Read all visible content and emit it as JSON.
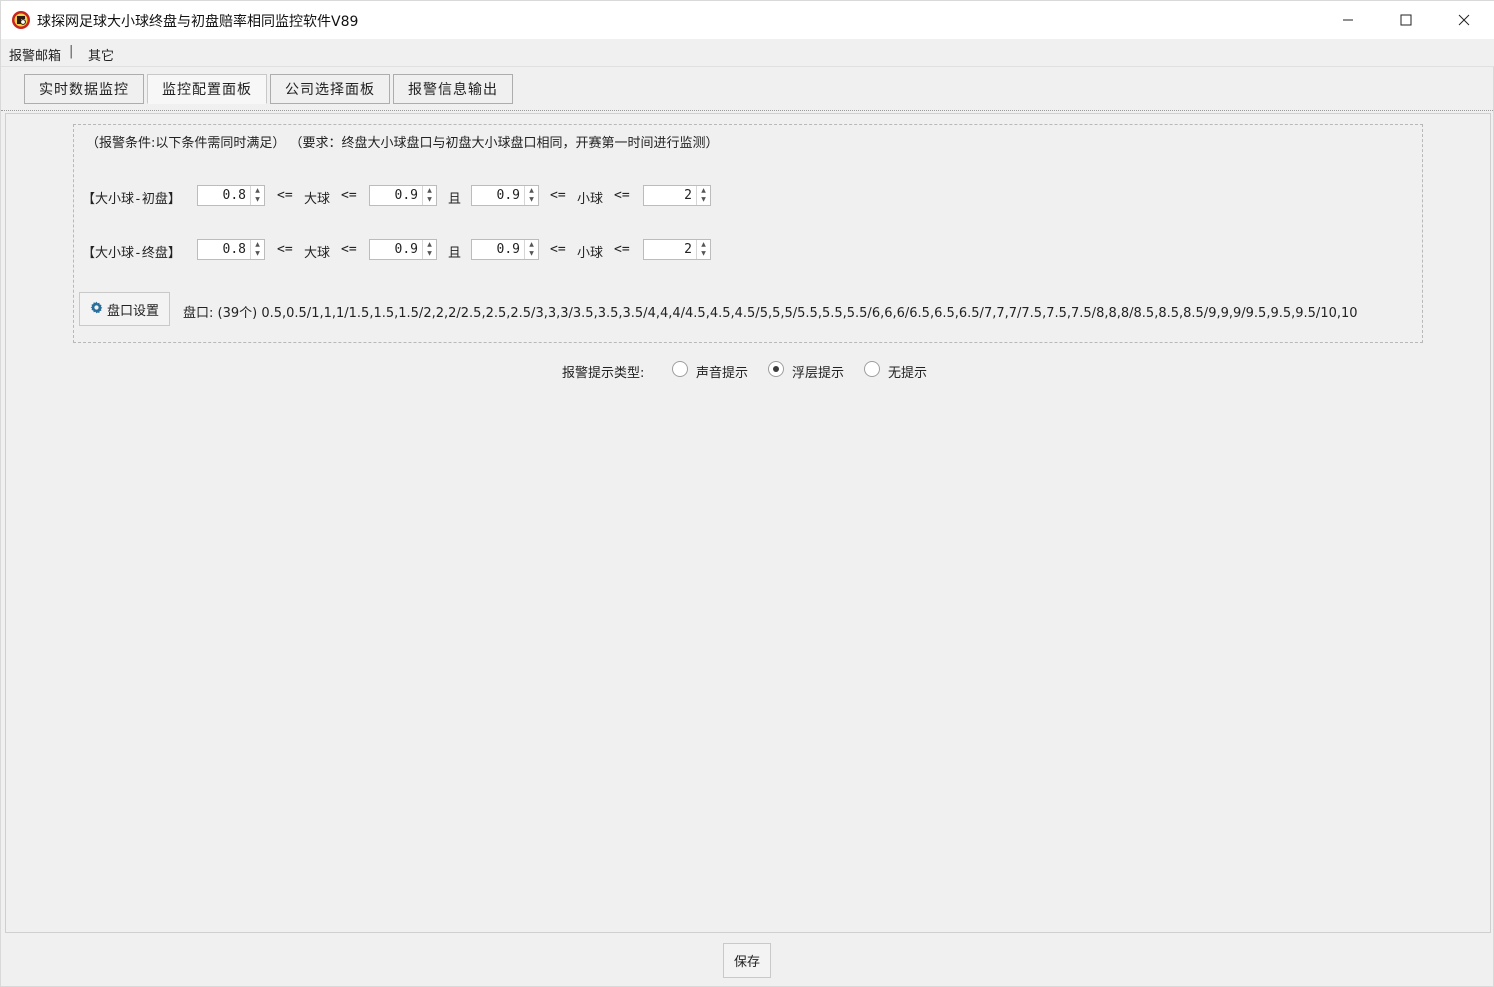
{
  "window": {
    "title": "球探网足球大小球终盘与初盘赔率相同监控软件V89"
  },
  "menu": {
    "items": [
      "报警邮箱",
      "其它"
    ],
    "separator": "|"
  },
  "tabs": [
    {
      "label": "实时数据监控",
      "active": false
    },
    {
      "label": "监控配置面板",
      "active": true
    },
    {
      "label": "公司选择面板",
      "active": false
    },
    {
      "label": "报警信息输出",
      "active": false
    }
  ],
  "conditions": {
    "title": "（报警条件:以下条件需同时满足） （要求：终盘大小球盘口与初盘大小球盘口相同，开赛第一时间进行监测）",
    "ops": {
      "le": "<=",
      "big": "大球",
      "and": "且",
      "small": "小球"
    },
    "rows": [
      {
        "label": "【大小球-初盘】",
        "big_min": "0.8",
        "big_max": "0.9",
        "small_min": "0.9",
        "small_max": "2"
      },
      {
        "label": "【大小球-终盘】",
        "big_min": "0.8",
        "big_max": "0.9",
        "small_min": "0.9",
        "small_max": "2"
      }
    ],
    "pan_button_label": "盘口设置",
    "pan_text": "盘口: (39个) 0.5,0.5/1,1,1/1.5,1.5,1.5/2,2,2/2.5,2.5,2.5/3,3,3/3.5,3.5,3.5/4,4,4/4.5,4.5,4.5/5,5,5/5.5,5.5,5.5/6,6,6/6.5,6.5,6.5/7,7,7/7.5,7.5,7.5/8,8,8/8.5,8.5,8.5/9,9,9/9.5,9.5,9.5/10,10"
  },
  "alarm": {
    "label": "报警提示类型:",
    "options": [
      {
        "label": "声音提示",
        "checked": false
      },
      {
        "label": "浮层提示",
        "checked": true
      },
      {
        "label": "无提示",
        "checked": false
      }
    ]
  },
  "footer": {
    "save_label": "保存"
  }
}
